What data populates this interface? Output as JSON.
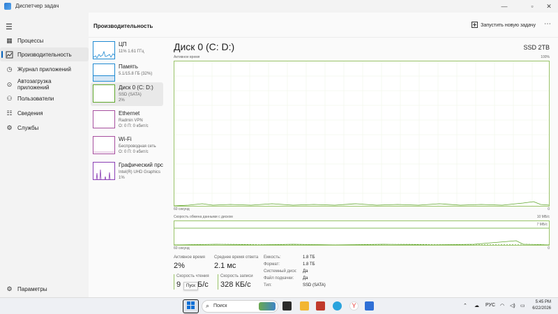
{
  "window": {
    "title": "Диспетчер задач",
    "controls": [
      "—",
      "▫",
      "✕"
    ]
  },
  "sidebar": {
    "items": [
      {
        "label": "Процессы",
        "icon": "processes-icon"
      },
      {
        "label": "Производительность",
        "icon": "performance-icon",
        "active": true
      },
      {
        "label": "Журнал приложений",
        "icon": "app-history-icon"
      },
      {
        "label": "Автозагрузка приложений",
        "icon": "startup-icon"
      },
      {
        "label": "Пользователи",
        "icon": "users-icon"
      },
      {
        "label": "Сведения",
        "icon": "details-icon"
      },
      {
        "label": "Службы",
        "icon": "services-icon"
      }
    ],
    "settings_label": "Параметры"
  },
  "header": {
    "title": "Производительность",
    "run_task_label": "Запустить новую задачу"
  },
  "perf_list": [
    {
      "name": "ЦП",
      "sub1": "11%  1.61 ГГц",
      "sub2": "",
      "color": "#1f8ad2"
    },
    {
      "name": "Память",
      "sub1": "5.1/15.8 ГБ (32%)",
      "sub2": "",
      "color": "#1f8ad2"
    },
    {
      "name": "Диск 0 (C: D:)",
      "sub1": "SSD (SATA)",
      "sub2": "2%",
      "color": "#5ea62a"
    },
    {
      "name": "Ethernet",
      "sub1": "Radmin VPN",
      "sub2": "О: 0  П: 0 кбит/с",
      "color": "#a74f9f"
    },
    {
      "name": "Wi-Fi",
      "sub1": "Беспроводная сеть",
      "sub2": "О: 0  П: 0 кбит/с",
      "color": "#a74f9f"
    },
    {
      "name": "Графический прс",
      "sub1": "Intel(R) UHD Graphics",
      "sub2": "1%",
      "color": "#8b3fb5"
    }
  ],
  "main": {
    "disk_title": "Диск 0 (C: D:)",
    "disk_model": "SSD 2TB",
    "graph1": {
      "label": "Активное время",
      "max_label": "100%",
      "time_label": "60 секунд",
      "min_label": "0"
    },
    "graph2": {
      "label": "Скорость обмена данными с диском",
      "max_label": "10 МБ/с",
      "line_label": "7 МБ/с",
      "time_label": "60 секунд",
      "min_label": "0"
    },
    "stats": {
      "active_time_label": "Активное время",
      "active_time_value": "2%",
      "avg_response_label": "Среднее время ответа",
      "avg_response_value": "2.1 мс",
      "read_speed_label": "Скорость чтения",
      "read_speed_value": "9",
      "read_speed_tail": "Б/с",
      "write_speed_label": "Скорость записи",
      "write_speed_value": "328 КБ/с"
    },
    "properties": [
      {
        "label": "Емкость:",
        "value": "1.8 ТБ"
      },
      {
        "label": "Формат:",
        "value": "1.8 ТБ"
      },
      {
        "label": "Системный диск:",
        "value": "Да"
      },
      {
        "label": "Файл подкачки:",
        "value": "Да"
      },
      {
        "label": "Тип:",
        "value": "SSD (SATA)"
      }
    ],
    "tooltip": "Пуск"
  },
  "taskbar": {
    "search_label": "Поиск",
    "tray_lang": "РУС",
    "time": "5:45 PM",
    "date": "6/22/2026"
  },
  "colors": {
    "accent": "#005fb8",
    "disk_green": "#9ac469",
    "cpu_blue": "#1f8ad2",
    "net_purple": "#a74f9f"
  }
}
